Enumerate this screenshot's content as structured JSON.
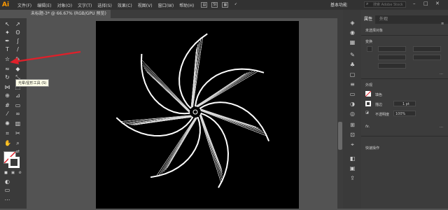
{
  "app": {
    "logo": "Ai"
  },
  "menu": {
    "items": [
      "文件(F)",
      "编辑(E)",
      "对象(O)",
      "文字(T)",
      "选择(S)",
      "效果(C)",
      "视图(V)",
      "窗口(W)",
      "帮助(H)"
    ]
  },
  "toolbar_icons": {
    "mode": "St"
  },
  "workspace": {
    "label": "基本功能"
  },
  "search": {
    "placeholder": "搜索 Adobe Stock"
  },
  "document": {
    "tab_title": "未标题-3* @ 66.67% (RGB/GPU 预览)"
  },
  "tooltip": {
    "text": "光晕/星形工具 (S)"
  },
  "panel": {
    "tabs": [
      "属性",
      "外观"
    ],
    "selection_label": "未选择对象",
    "transform_label": "变换",
    "appearance_label": "外观",
    "fill_label": "填色",
    "stroke_label": "描边",
    "stroke_value": "1 pt",
    "opacity_label": "不透明度",
    "opacity_value": "100%",
    "fx_label": "fx.",
    "quick_actions_label": "快速操作"
  },
  "colors": {
    "accent": "#ff9a00",
    "arrow": "#e0202a"
  }
}
